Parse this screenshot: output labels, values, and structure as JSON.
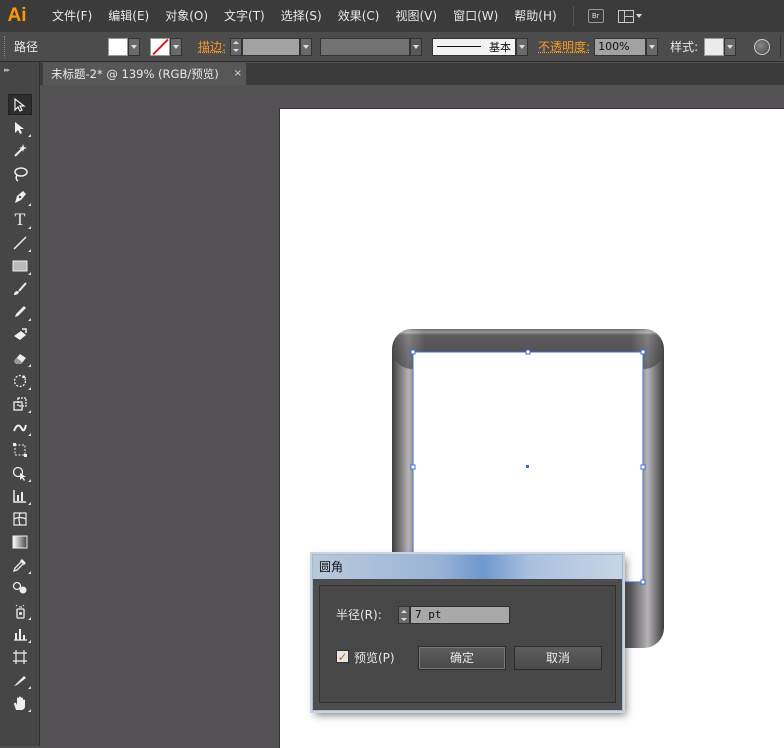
{
  "app": {
    "logo": "Ai"
  },
  "menu": [
    "文件(F)",
    "编辑(E)",
    "对象(O)",
    "文字(T)",
    "选择(S)",
    "效果(C)",
    "视图(V)",
    "窗口(W)",
    "帮助(H)"
  ],
  "menu_extras": {
    "bridge_label": "Br"
  },
  "control_bar": {
    "selection_label": "路径",
    "stroke_label": "描边:",
    "stroke_profile": "基本",
    "opacity_label": "不透明度:",
    "opacity_value": "100%",
    "style_label": "样式:"
  },
  "document_tab": {
    "title": "未标题-2* @ 139% (RGB/预览)",
    "close": "×"
  },
  "toolbox": {
    "collapse_glyph": "▸▸"
  },
  "dialog": {
    "title": "圆角",
    "radius_label": "半径(R):",
    "radius_value": "7 pt",
    "preview_checked": true,
    "check_glyph": "✓",
    "preview_label": "预览(P)",
    "ok_label": "确定",
    "cancel_label": "取消"
  },
  "colors": {
    "accent_orange": "#f39a26",
    "selection_blue": "#3d6cd0",
    "shape_gray": "#5d5b5d"
  }
}
